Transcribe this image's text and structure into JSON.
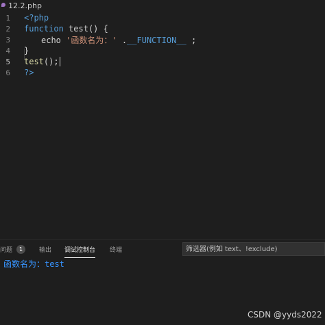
{
  "tab": {
    "filename": "12.2.php",
    "icon": "php-file-icon"
  },
  "editor": {
    "line_numbers": [
      "1",
      "2",
      "3",
      "4",
      "5",
      "6"
    ],
    "active_line": "5",
    "lines": {
      "l1": {
        "open_tag": "<?php"
      },
      "l2": {
        "kw": "function",
        "name": "test",
        "rest": "() {"
      },
      "l3": {
        "echo": "echo",
        "str": "'函数名为：'",
        "dot": " .",
        "const": "__FUNCTION__",
        "end": " ;"
      },
      "l4": {
        "close": "}"
      },
      "l5": {
        "name": "test",
        "rest": "();"
      },
      "l6": {
        "close_tag": "?>"
      }
    }
  },
  "panel": {
    "tabs": {
      "problems": "问题",
      "problems_count": "1",
      "output": "输出",
      "debug_console": "调试控制台",
      "terminal": "终端"
    },
    "filter_placeholder": "筛选器(例如 text、!exclude)",
    "output_text": "函数名为：test"
  },
  "watermark": "CSDN @yyds2022",
  "colors": {
    "background": "#1e1e1e",
    "keyword": "#569cd6",
    "function": "#dcdcaa",
    "string": "#ce9178",
    "output": "#3794ff"
  }
}
